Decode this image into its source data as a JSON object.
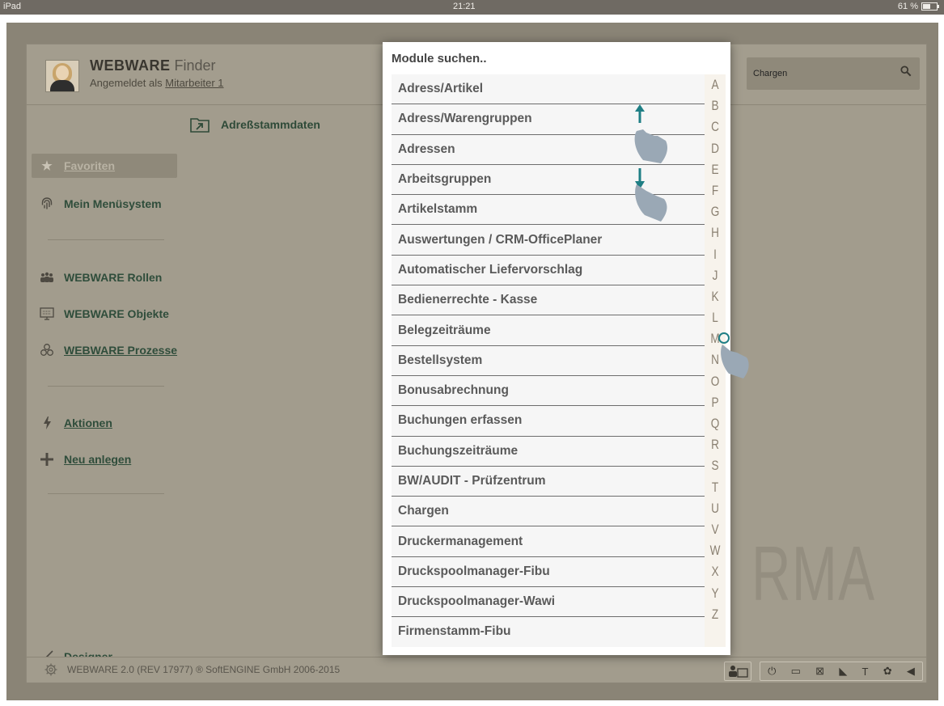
{
  "status_bar": {
    "device": "iPad",
    "time": "21:21",
    "battery": "61 %"
  },
  "header": {
    "brand_bold": "WEBWARE",
    "brand_light": "Finder",
    "login_prefix": "Angemeldet als",
    "login_user": "Mitarbeiter 1",
    "search_value": "Chargen"
  },
  "sidebar": {
    "items": [
      {
        "label": "Favoriten",
        "icon": "star-icon"
      },
      {
        "label": "Mein Menüsystem",
        "icon": "fingerprint-icon"
      },
      {
        "label": "WEBWARE Rollen",
        "icon": "people-icon"
      },
      {
        "label": "WEBWARE Objekte",
        "icon": "monitor-icon"
      },
      {
        "label": "WEBWARE Prozesse",
        "icon": "process-icon"
      },
      {
        "label": "Aktionen",
        "icon": "lightning-icon"
      },
      {
        "label": "Neu anlegen",
        "icon": "plus-icon"
      },
      {
        "label": "Designer",
        "icon": "brush-icon"
      }
    ]
  },
  "content": {
    "folder_label": "Adreßstammdaten",
    "watermark": "RMA"
  },
  "footer": {
    "text": "WEBWARE 2.0 (REV 17977) ® SoftENGINE GmbH 2006-2015"
  },
  "modal": {
    "title": "Module suchen..",
    "items": [
      "Adress/Artikel",
      "Adress/Warengruppen",
      "Adressen",
      "Arbeitsgruppen",
      "Artikelstamm",
      "Auswertungen / CRM-OfficePlaner",
      "Automatischer Liefervorschlag",
      "Bedienerrechte - Kasse",
      "Belegzeiträume",
      "Bestellsystem",
      "Bonusabrechnung",
      "Buchungen erfassen",
      "Buchungszeiträume",
      "BW/AUDIT - Prüfzentrum",
      "Chargen",
      "Druckermanagement",
      "Druckspoolmanager-Fibu",
      "Druckspoolmanager-Wawi",
      "Firmenstamm-Fibu"
    ],
    "alphabet": [
      "A",
      "B",
      "C",
      "D",
      "E",
      "F",
      "G",
      "H",
      "I",
      "J",
      "K",
      "L",
      "M",
      "N",
      "O",
      "P",
      "Q",
      "R",
      "S",
      "T",
      "U",
      "V",
      "W",
      "X",
      "Y",
      "Z"
    ]
  },
  "colors": {
    "accent_green": "#2f4d3b",
    "teal_arrow": "#1f7f85",
    "hand": "#9aa8b5"
  }
}
